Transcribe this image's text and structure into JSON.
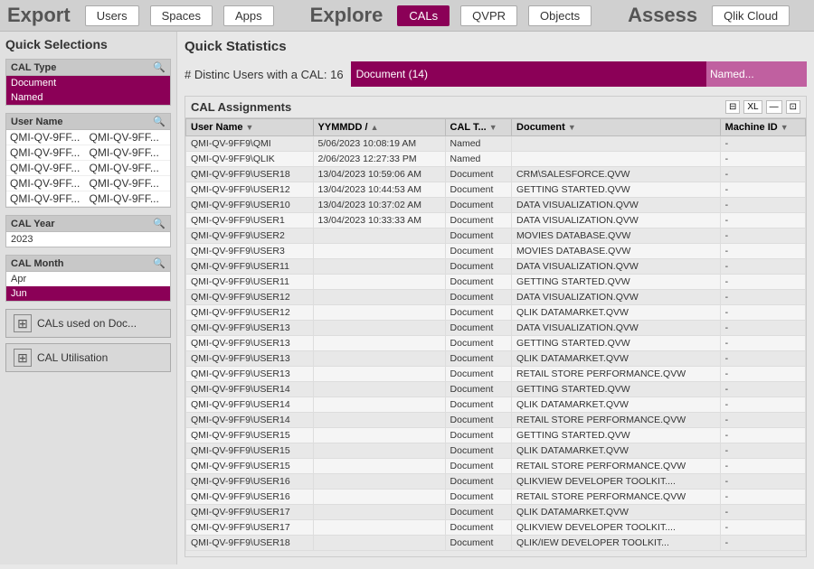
{
  "topNav": {
    "sections": [
      {
        "title": "Export",
        "buttons": [
          "Users",
          "Spaces",
          "Apps"
        ]
      },
      {
        "title": "Explore",
        "buttons": [
          "CALs",
          "QVPR",
          "Objects"
        ],
        "activeButton": "CALs"
      },
      {
        "title": "Assess",
        "buttons": [
          "Qlik Cloud"
        ]
      }
    ]
  },
  "sidebar": {
    "quickSelectionsTitle": "Quick Selections",
    "calTypeFilter": {
      "label": "CAL Type",
      "items": [
        {
          "value": "Document",
          "selected": true
        },
        {
          "value": "Named",
          "selected": true
        }
      ]
    },
    "userNameFilter": {
      "label": "User Name",
      "rows": [
        [
          "QMI-QV-9FF...",
          "QMI-QV-9FF..."
        ],
        [
          "QMI-QV-9FF...",
          "QMI-QV-9FF..."
        ],
        [
          "QMI-QV-9FF...",
          "QMI-QV-9FF..."
        ],
        [
          "QMI-QV-9FF...",
          "QMI-QV-9FF..."
        ],
        [
          "QMI-QV-9FF...",
          "QMI-QV-9FF..."
        ]
      ]
    },
    "calYearFilter": {
      "label": "CAL Year",
      "items": [
        "2023"
      ]
    },
    "calMonthFilter": {
      "label": "CAL Month",
      "items": [
        {
          "value": "Apr",
          "selected": false
        },
        {
          "value": "Jun",
          "selected": true
        }
      ]
    },
    "buttons": [
      {
        "label": "CALs used on Doc...",
        "icon": "⊞"
      },
      {
        "label": "CAL Utilisation",
        "icon": "⊞"
      }
    ]
  },
  "quickStats": {
    "title": "Quick Statistics",
    "metric": "# Distinc Users with a CAL: 16",
    "bars": [
      {
        "label": "Document (14)",
        "color": "#8b0057",
        "width": "78%"
      },
      {
        "label": "Named...",
        "color": "#c060a0",
        "width": "22%"
      }
    ]
  },
  "calAssignments": {
    "title": "CAL Assignments",
    "controls": [
      "⊟",
      "XL",
      "—",
      "⊡"
    ],
    "columns": [
      "User Name",
      "YYMMDD /",
      "CAL T...",
      "Document",
      "Machine ID"
    ],
    "rows": [
      [
        "QMI-QV-9FF9\\QMI",
        "5/06/2023 10:08:19 AM",
        "Named",
        "",
        "-"
      ],
      [
        "QMI-QV-9FF9\\QLIK",
        "2/06/2023 12:27:33 PM",
        "Named",
        "",
        "-"
      ],
      [
        "QMI-QV-9FF9\\USER18",
        "13/04/2023 10:59:06 AM",
        "Document",
        "CRM\\SALESFORCE.QVW",
        "-"
      ],
      [
        "QMI-QV-9FF9\\USER12",
        "13/04/2023 10:44:53 AM",
        "Document",
        "GETTING STARTED.QVW",
        "-"
      ],
      [
        "QMI-QV-9FF9\\USER10",
        "13/04/2023 10:37:02 AM",
        "Document",
        "DATA VISUALIZATION.QVW",
        "-"
      ],
      [
        "QMI-QV-9FF9\\USER1",
        "13/04/2023 10:33:33 AM",
        "Document",
        "DATA VISUALIZATION.QVW",
        "-"
      ],
      [
        "QMI-QV-9FF9\\USER2",
        "",
        "Document",
        "MOVIES DATABASE.QVW",
        "-"
      ],
      [
        "QMI-QV-9FF9\\USER3",
        "",
        "Document",
        "MOVIES DATABASE.QVW",
        "-"
      ],
      [
        "QMI-QV-9FF9\\USER11",
        "",
        "Document",
        "DATA VISUALIZATION.QVW",
        "-"
      ],
      [
        "QMI-QV-9FF9\\USER11",
        "",
        "Document",
        "GETTING STARTED.QVW",
        "-"
      ],
      [
        "QMI-QV-9FF9\\USER12",
        "",
        "Document",
        "DATA VISUALIZATION.QVW",
        "-"
      ],
      [
        "QMI-QV-9FF9\\USER12",
        "",
        "Document",
        "QLIK DATAMARKET.QVW",
        "-"
      ],
      [
        "QMI-QV-9FF9\\USER13",
        "",
        "Document",
        "DATA VISUALIZATION.QVW",
        "-"
      ],
      [
        "QMI-QV-9FF9\\USER13",
        "",
        "Document",
        "GETTING STARTED.QVW",
        "-"
      ],
      [
        "QMI-QV-9FF9\\USER13",
        "",
        "Document",
        "QLIK DATAMARKET.QVW",
        "-"
      ],
      [
        "QMI-QV-9FF9\\USER13",
        "",
        "Document",
        "RETAIL STORE PERFORMANCE.QVW",
        "-"
      ],
      [
        "QMI-QV-9FF9\\USER14",
        "",
        "Document",
        "GETTING STARTED.QVW",
        "-"
      ],
      [
        "QMI-QV-9FF9\\USER14",
        "",
        "Document",
        "QLIK DATAMARKET.QVW",
        "-"
      ],
      [
        "QMI-QV-9FF9\\USER14",
        "",
        "Document",
        "RETAIL STORE PERFORMANCE.QVW",
        "-"
      ],
      [
        "QMI-QV-9FF9\\USER15",
        "",
        "Document",
        "GETTING STARTED.QVW",
        "-"
      ],
      [
        "QMI-QV-9FF9\\USER15",
        "",
        "Document",
        "QLIK DATAMARKET.QVW",
        "-"
      ],
      [
        "QMI-QV-9FF9\\USER15",
        "",
        "Document",
        "RETAIL STORE PERFORMANCE.QVW",
        "-"
      ],
      [
        "QMI-QV-9FF9\\USER16",
        "",
        "Document",
        "QLIKVIEW DEVELOPER TOOLKIT....",
        "-"
      ],
      [
        "QMI-QV-9FF9\\USER16",
        "",
        "Document",
        "RETAIL STORE PERFORMANCE.QVW",
        "-"
      ],
      [
        "QMI-QV-9FF9\\USER17",
        "",
        "Document",
        "QLIK DATAMARKET.QVW",
        "-"
      ],
      [
        "QMI-QV-9FF9\\USER17",
        "",
        "Document",
        "QLIKVIEW DEVELOPER TOOLKIT....",
        "-"
      ],
      [
        "QMI-QV-9FF9\\USER18",
        "",
        "Document",
        "QLIK/IEW DEVELOPER TOOLKIT...",
        "-"
      ]
    ]
  }
}
